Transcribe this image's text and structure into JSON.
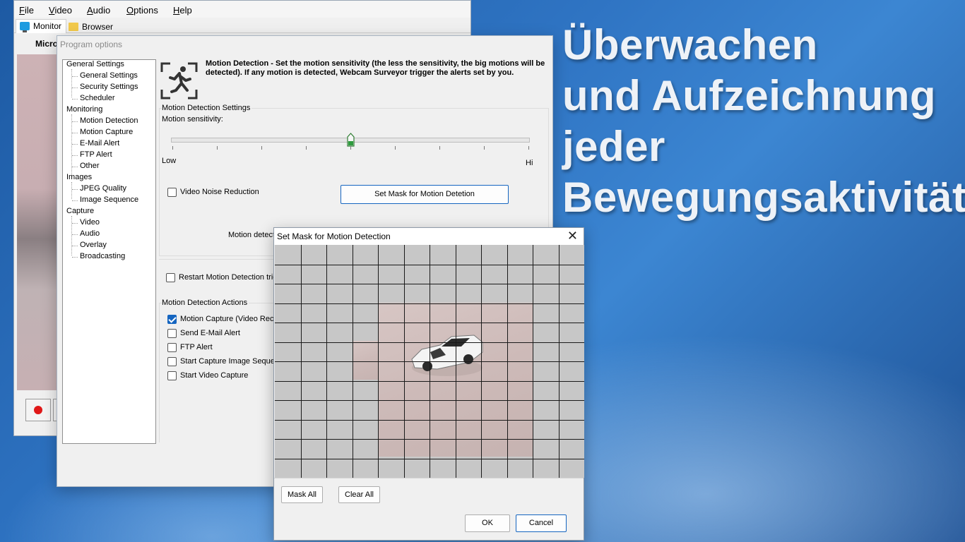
{
  "headline": {
    "line1": "Überwachen",
    "line2": "und Aufzeichnung",
    "line3": "jeder",
    "line4": "Bewegungsaktivität"
  },
  "main_window": {
    "menu": [
      "File",
      "Video",
      "Audio",
      "Options",
      "Help"
    ],
    "tabs": [
      "Monitor",
      "Browser"
    ],
    "camera_title": "Micro"
  },
  "program_options": {
    "title": "Program options",
    "tree": [
      {
        "label": "General Settings",
        "level": 0
      },
      {
        "label": "General Settings",
        "level": 1
      },
      {
        "label": "Security Settings",
        "level": 1
      },
      {
        "label": "Scheduler",
        "level": 1
      },
      {
        "label": "Monitoring",
        "level": 0
      },
      {
        "label": "Motion Detection",
        "level": 1
      },
      {
        "label": "Motion Capture",
        "level": 1
      },
      {
        "label": "E-Mail Alert",
        "level": 1
      },
      {
        "label": "FTP Alert",
        "level": 1
      },
      {
        "label": "Other",
        "level": 1
      },
      {
        "label": "Images",
        "level": 0
      },
      {
        "label": "JPEG Quality",
        "level": 1
      },
      {
        "label": "Image Sequence",
        "level": 1
      },
      {
        "label": "Capture",
        "level": 0
      },
      {
        "label": "Video",
        "level": 1
      },
      {
        "label": "Audio",
        "level": 1
      },
      {
        "label": "Overlay",
        "level": 1
      },
      {
        "label": "Broadcasting",
        "level": 1
      }
    ],
    "header_text": "Motion Detection - Set the motion sensitivity (the less the sensitivity, the big motions will be detected). If any motion is detected, Webcam Surveyor trigger the alerts set by you.",
    "settings_group": "Motion Detection Settings",
    "sensitivity_label": "Motion sensitivity:",
    "sensitivity_value": 0.5,
    "low_label": "Low",
    "hi_label": "Hi",
    "video_noise_reduction": {
      "label": "Video Noise Reduction",
      "checked": false
    },
    "set_mask_button": "Set Mask for Motion Detetion",
    "motion_detect_label": "Motion detect",
    "restart_label": "Restart Motion Detection trig",
    "actions_group": "Motion Detection Actions",
    "actions": [
      {
        "label": "Motion Capture (Video Reco",
        "checked": true
      },
      {
        "label": "Send E-Mail  Alert",
        "checked": false
      },
      {
        "label": "FTP Alert",
        "checked": false
      },
      {
        "label": "Start Capture Image Seque",
        "checked": false
      },
      {
        "label": "Start Video Capture",
        "checked": false
      }
    ]
  },
  "mask_dialog": {
    "title": "Set Mask for Motion Detection",
    "close_icon": "close-icon",
    "grid_columns": 12,
    "grid_rows": 12,
    "mask_all": "Mask All",
    "clear_all": "Clear All",
    "ok": "OK",
    "cancel": "Cancel"
  },
  "colors": {
    "accent": "#1565c0",
    "mask_cell": "#c7c7c7",
    "record": "#e01818"
  }
}
